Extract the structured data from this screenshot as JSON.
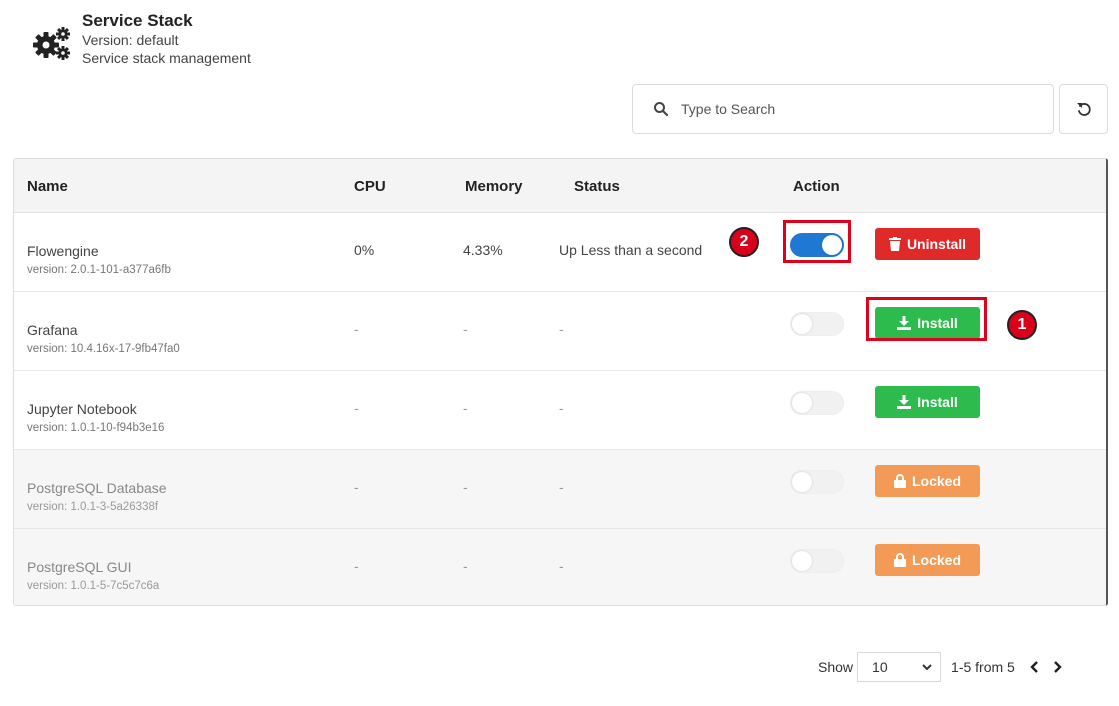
{
  "header": {
    "title": "Service Stack",
    "version": "Version: default",
    "description": "Service stack management",
    "icon": "gears-icon"
  },
  "search": {
    "placeholder": "Type to Search",
    "value": ""
  },
  "table": {
    "columns": [
      "Name",
      "CPU",
      "Memory",
      "Status",
      "Action"
    ],
    "rows": [
      {
        "name": "Flowengine",
        "version": "version: 2.0.1-101-a377a6fb",
        "cpu": "0%",
        "memory": "4.33%",
        "status": "Up Less than a second",
        "toggle": true,
        "action": "Uninstall",
        "action_type": "uninstall"
      },
      {
        "name": "Grafana",
        "version": "version: 10.4.16x-17-9fb47fa0",
        "cpu": "-",
        "memory": "-",
        "status": "-",
        "toggle": false,
        "action": "Install",
        "action_type": "install"
      },
      {
        "name": "Jupyter Notebook",
        "version": "version: 1.0.1-10-f94b3e16",
        "cpu": "-",
        "memory": "-",
        "status": "-",
        "toggle": false,
        "action": "Install",
        "action_type": "install"
      },
      {
        "name": "PostgreSQL Database",
        "version": "version: 1.0.1-3-5a26338f",
        "cpu": "-",
        "memory": "-",
        "status": "-",
        "toggle": false,
        "action": "Locked",
        "action_type": "locked"
      },
      {
        "name": "PostgreSQL GUI",
        "version": "version: 1.0.1-5-7c5c7c6a",
        "cpu": "-",
        "memory": "-",
        "status": "-",
        "toggle": false,
        "action": "Locked",
        "action_type": "locked"
      }
    ]
  },
  "annotations": {
    "marker1": "1",
    "marker2": "2"
  },
  "pagination": {
    "show_label": "Show",
    "page_size": "10",
    "range": "1-5 from 5"
  },
  "colors": {
    "uninstall": "#e02a2a",
    "install": "#2dbb4d",
    "locked": "#f49a57",
    "toggle_on": "#1f78d1",
    "marker": "#d8001b"
  }
}
